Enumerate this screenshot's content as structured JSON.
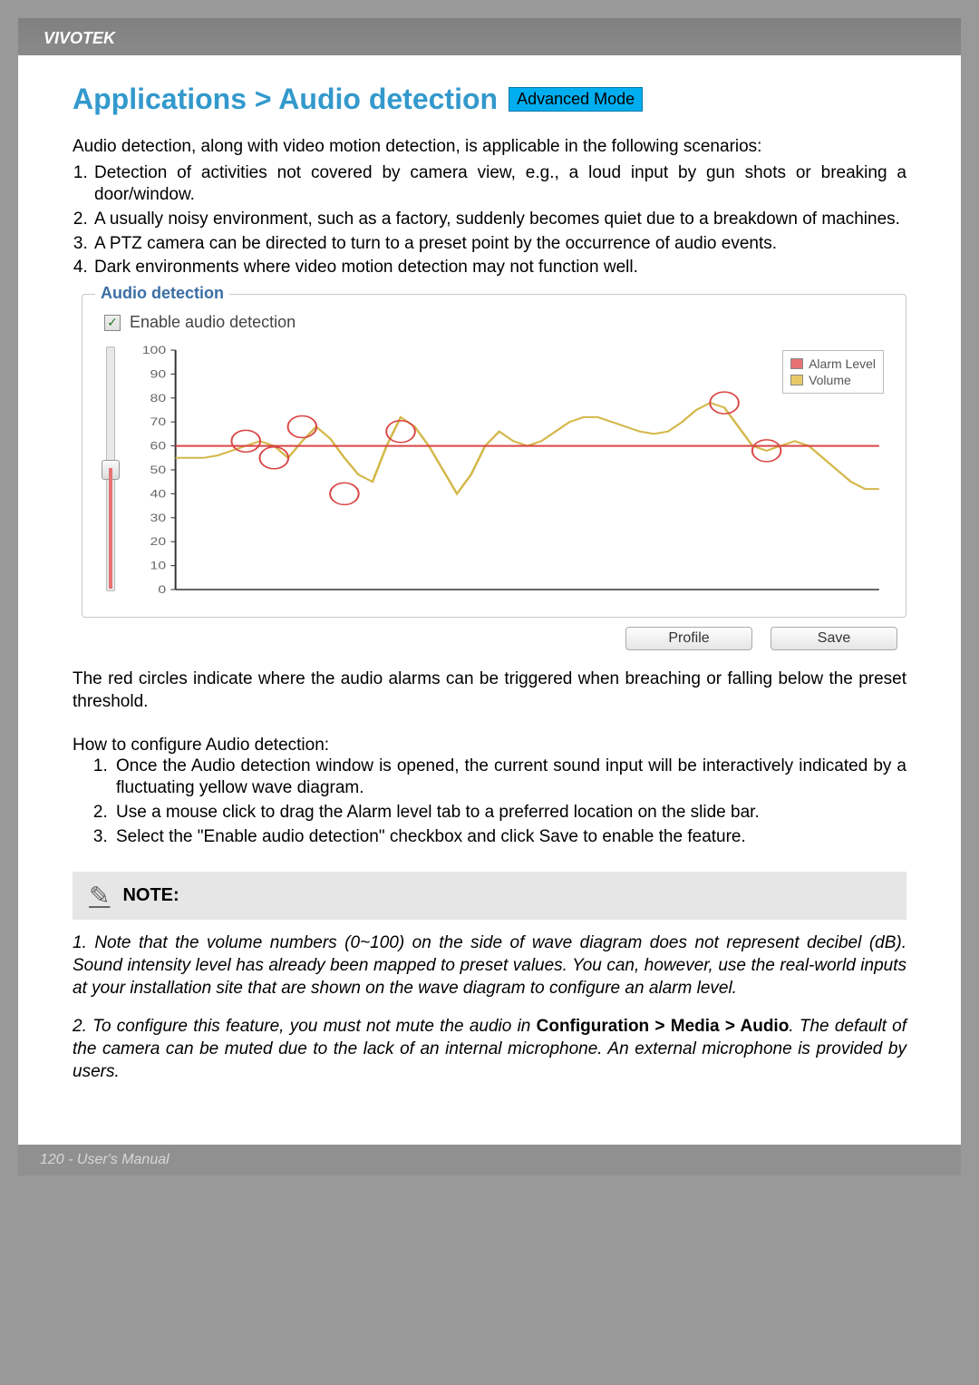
{
  "brand": "VIVOTEK",
  "heading": "Applications > Audio detection",
  "mode_badge": "Advanced Mode",
  "intro": "Audio detection, along with video motion detection, is applicable in the following scenarios:",
  "scenarios": [
    "Detection of activities not covered by camera view, e.g., a loud input by gun shots or breaking a door/window.",
    "A usually noisy environment, such as a factory, suddenly becomes quiet due to a breakdown of machines.",
    "A PTZ camera can be directed to turn to a preset point by the occurrence of audio events.",
    "Dark environments where video motion detection may not function well."
  ],
  "panel": {
    "title": "Audio detection",
    "checkbox_label": "Enable audio detection",
    "checkbox_checked": true,
    "legend_alarm": "Alarm Level",
    "legend_volume": "Volume",
    "buttons": {
      "profile": "Profile",
      "save": "Save"
    }
  },
  "chart_data": {
    "type": "line",
    "title": "",
    "xlabel": "",
    "ylabel": "",
    "ylim": [
      0,
      100
    ],
    "y_ticks": [
      0,
      10,
      20,
      30,
      40,
      50,
      60,
      70,
      80,
      90,
      100
    ],
    "alarm_level": 60,
    "slider_value": 50,
    "series": [
      {
        "name": "Volume",
        "color": "#d4b84a",
        "x": [
          0,
          2,
          4,
          6,
          8,
          10,
          12,
          14,
          16,
          18,
          20,
          22,
          24,
          26,
          28,
          30,
          32,
          34,
          36,
          38,
          40,
          42,
          44,
          46,
          48,
          50,
          52,
          54,
          56,
          58,
          60,
          62,
          64,
          66,
          68,
          70,
          72,
          74,
          76,
          78,
          80,
          82,
          84,
          86,
          88,
          90,
          92,
          94,
          96,
          98,
          100
        ],
        "values": [
          55,
          55,
          55,
          56,
          58,
          60,
          62,
          60,
          55,
          62,
          68,
          63,
          55,
          48,
          45,
          60,
          72,
          68,
          60,
          50,
          40,
          48,
          60,
          66,
          62,
          60,
          62,
          66,
          70,
          72,
          72,
          70,
          68,
          66,
          65,
          66,
          70,
          75,
          78,
          76,
          68,
          60,
          58,
          60,
          62,
          60,
          55,
          50,
          45,
          42,
          42
        ]
      },
      {
        "name": "Alarm Level",
        "color": "#d94444",
        "x": [
          0,
          100
        ],
        "values": [
          60,
          60
        ]
      }
    ],
    "markers": [
      {
        "x": 10,
        "y": 62
      },
      {
        "x": 14,
        "y": 55
      },
      {
        "x": 18,
        "y": 68
      },
      {
        "x": 24,
        "y": 40
      },
      {
        "x": 32,
        "y": 66
      },
      {
        "x": 78,
        "y": 78
      },
      {
        "x": 84,
        "y": 58
      }
    ]
  },
  "explain": "The red circles indicate where the audio alarms can be triggered when breaching or falling below the preset threshold.",
  "how_title": "How to configure Audio detection:",
  "steps": [
    "Once the Audio detection window is opened, the current sound input will be interactively indicated by a fluctuating yellow wave diagram.",
    "Use a mouse click to drag the Alarm level tab to a preferred location on the slide bar.",
    "Select the \"Enable audio detection\" checkbox and click Save to enable the feature."
  ],
  "note_label": "NOTE:",
  "notes_1a": "1. Note that the volume numbers (0~100) on the side of wave diagram does not represent decibel (dB). Sound intensity level has already been mapped to preset values. You can, however, use the real-world inputs at your installation site that are shown on the wave diagram to configure an alarm level.",
  "notes_2a": "2. To configure this feature, you must not mute the audio in ",
  "notes_2b": "Configuration > Media > Audio",
  "notes_2c": ". The default of the camera can be muted due to the lack of an internal microphone. An external microphone is provided by users.",
  "footer": "120 - User's Manual"
}
